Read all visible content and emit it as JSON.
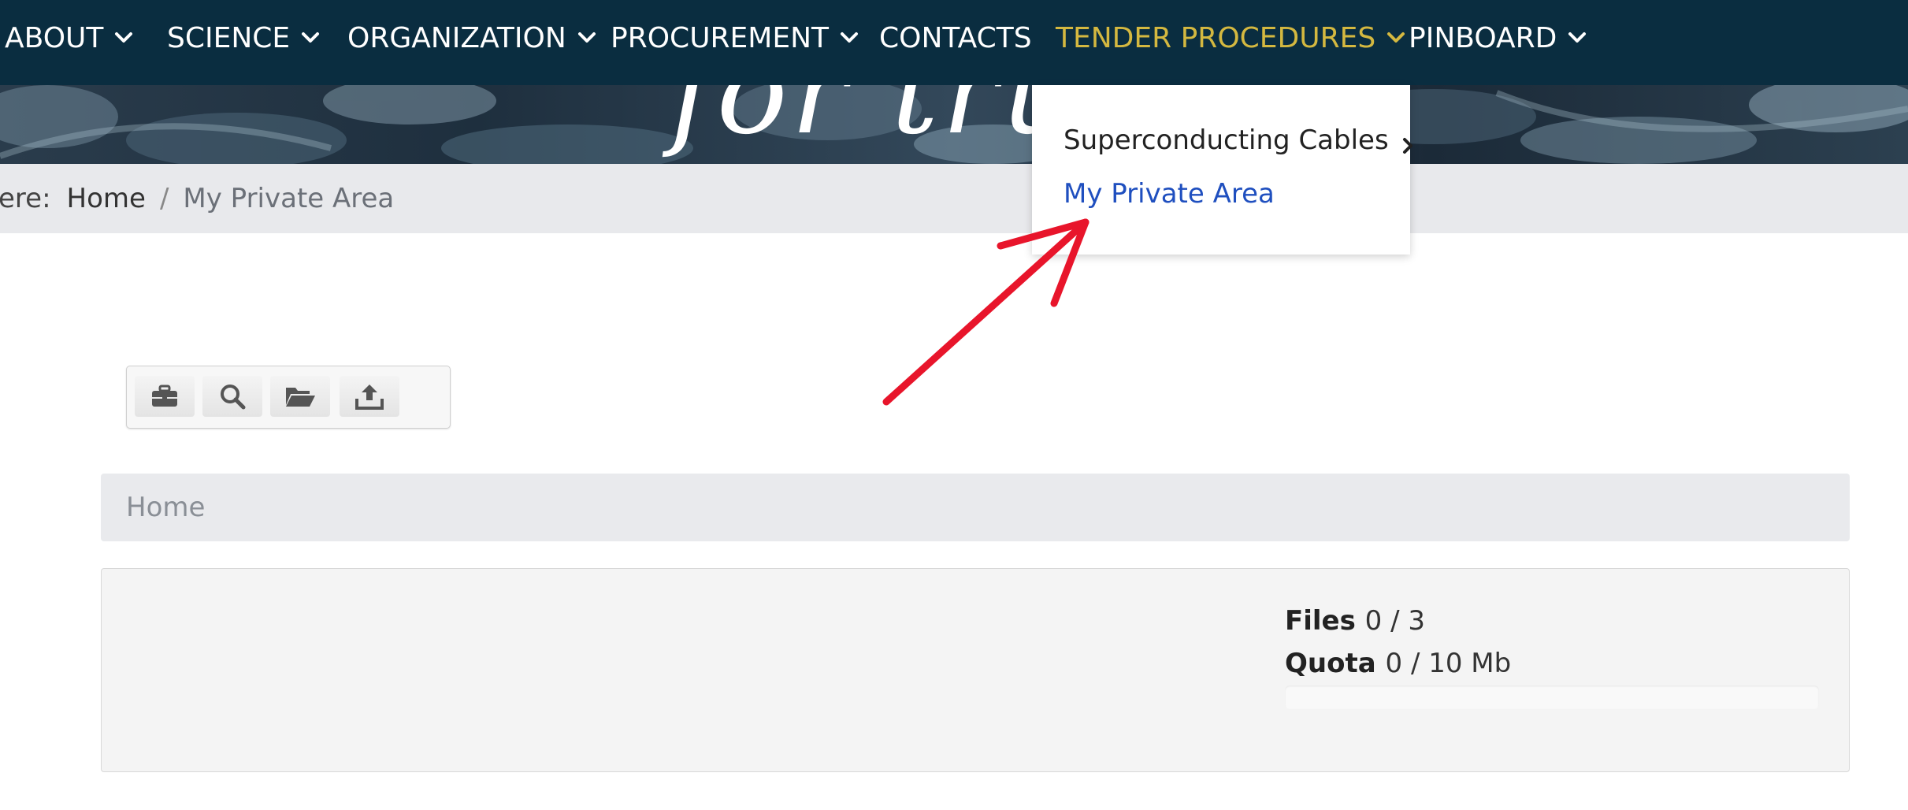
{
  "nav": {
    "items": [
      {
        "label": "ABOUT"
      },
      {
        "label": "SCIENCE"
      },
      {
        "label": "ORGANIZATION"
      },
      {
        "label": "PROCUREMENT"
      },
      {
        "label": "CONTACTS"
      },
      {
        "label": "TENDER PROCEDURES"
      },
      {
        "label": "PINBOARD"
      }
    ],
    "active_item": "TENDER PROCEDURES",
    "colors": {
      "background": "#0a2d40",
      "text": "#ffffff",
      "active": "#d4b840"
    }
  },
  "hero": {
    "script_text": "for tru"
  },
  "breadcrumb": {
    "prefix": "ere:",
    "home": "Home",
    "separator": "/",
    "current": "My Private Area"
  },
  "dropdown": {
    "items": [
      {
        "label": "Superconducting Cables",
        "has_submenu": true
      },
      {
        "label": "My Private Area",
        "has_submenu": false
      }
    ],
    "link_color": "#1f4fbf"
  },
  "annotation": {
    "type": "arrow",
    "color": "#e8152b"
  },
  "toolbar": {
    "buttons": [
      {
        "icon": "briefcase-icon"
      },
      {
        "icon": "search-icon"
      },
      {
        "icon": "folder-open-icon"
      },
      {
        "icon": "upload-icon"
      }
    ]
  },
  "path": {
    "home": "Home"
  },
  "stats": {
    "files_label": "Files",
    "files_value": "0 / 3",
    "quota_label": "Quota",
    "quota_value": "0 / 10 Mb",
    "quota_used_fraction": 0
  }
}
